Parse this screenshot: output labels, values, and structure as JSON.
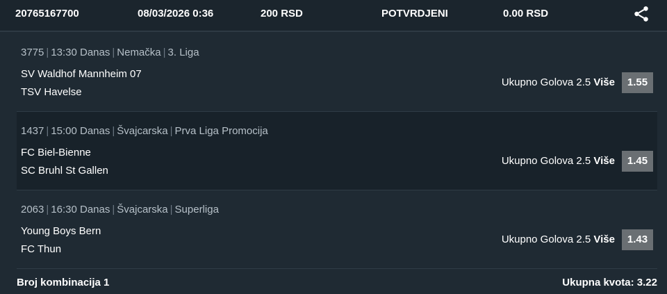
{
  "header": {
    "ticket_id": "20765167700",
    "datetime": "08/03/2026 0:36",
    "stake": "200 RSD",
    "status": "POTVRDJENI",
    "winnings": "0.00 RSD",
    "share_icon": "share-icon"
  },
  "events": [
    {
      "code": "3775",
      "time": "13:30 Danas",
      "country": "Nemačka",
      "league": "3. Liga",
      "home": "SV Waldhof Mannheim 07",
      "away": "TSV Havelse",
      "market": "Ukupno Golova 2.5",
      "pick": "Više",
      "odds": "1.55"
    },
    {
      "code": "1437",
      "time": "15:00 Danas",
      "country": "Švajcarska",
      "league": "Prva Liga Promocija",
      "home": "FC Biel-Bienne",
      "away": "SC Bruhl St Gallen",
      "market": "Ukupno Golova 2.5",
      "pick": "Više",
      "odds": "1.45"
    },
    {
      "code": "2063",
      "time": "16:30 Danas",
      "country": "Švajcarska",
      "league": "Superliga",
      "home": "Young Boys Bern",
      "away": "FC Thun",
      "market": "Ukupno Golova 2.5",
      "pick": "Više",
      "odds": "1.43"
    }
  ],
  "footer": {
    "combinations": "Broj kombinacija 1",
    "total_odds": "Ukupna kvota: 3.22"
  },
  "colors": {
    "background": "#1f2a33",
    "header_background": "#1b252d",
    "alt_row": "#18222a",
    "odds_box": "#6a6f73",
    "meta_text": "#b6c0c8"
  }
}
